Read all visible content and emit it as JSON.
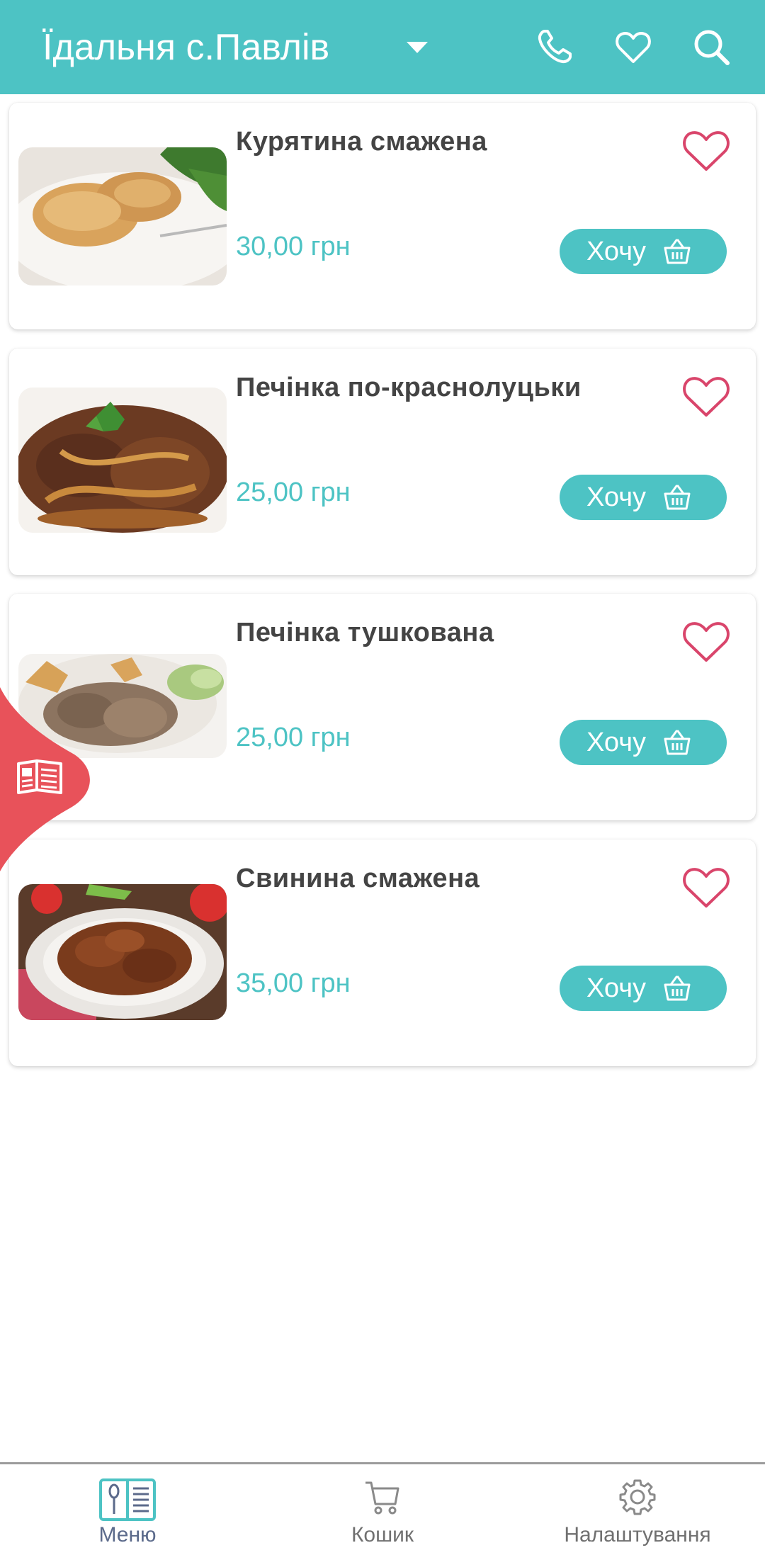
{
  "header": {
    "title": "Їдальня с.Павлів",
    "icons": [
      "chevron-down-icon",
      "phone-icon",
      "heart-icon",
      "search-icon"
    ]
  },
  "menu_items": [
    {
      "title": "Курятина смажена",
      "price": "30,00 грн",
      "button_label": "Хочу"
    },
    {
      "title": "Печінка по-краснолуцьки",
      "price": "25,00 грн",
      "button_label": "Хочу"
    },
    {
      "title": "Печінка тушкована",
      "price": "25,00 грн",
      "button_label": "Хочу"
    },
    {
      "title": "Свинина смажена",
      "price": "35,00 грн",
      "button_label": "Хочу"
    }
  ],
  "bottom_nav": {
    "menu_label": "Меню",
    "cart_label": "Кошик",
    "settings_label": "Налаштування",
    "active": "menu"
  },
  "colors": {
    "brand": "#4dc3c4",
    "favorite": "#d9456b",
    "accent_blob": "#e8525a",
    "title_text": "#444444"
  }
}
